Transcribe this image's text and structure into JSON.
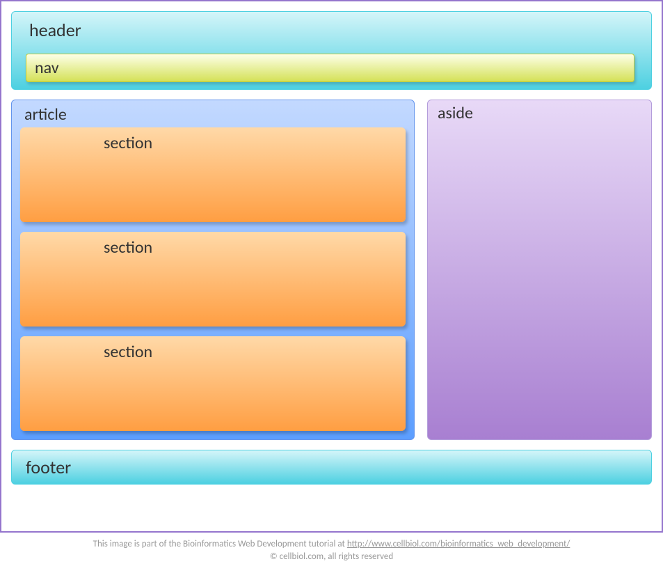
{
  "header": {
    "label": "header",
    "nav_label": "nav"
  },
  "article": {
    "label": "article",
    "sections": [
      {
        "label": "section"
      },
      {
        "label": "section"
      },
      {
        "label": "section"
      }
    ]
  },
  "aside": {
    "label": "aside"
  },
  "footer": {
    "label": "footer"
  },
  "attribution": {
    "line1_prefix": "This image is part of the Bioinformatics Web Development tutorial at  ",
    "line1_url": "http://www.cellbiol.com/bioinformatics_web_development/",
    "line2": "© cellbiol.com, all rights reserved"
  }
}
